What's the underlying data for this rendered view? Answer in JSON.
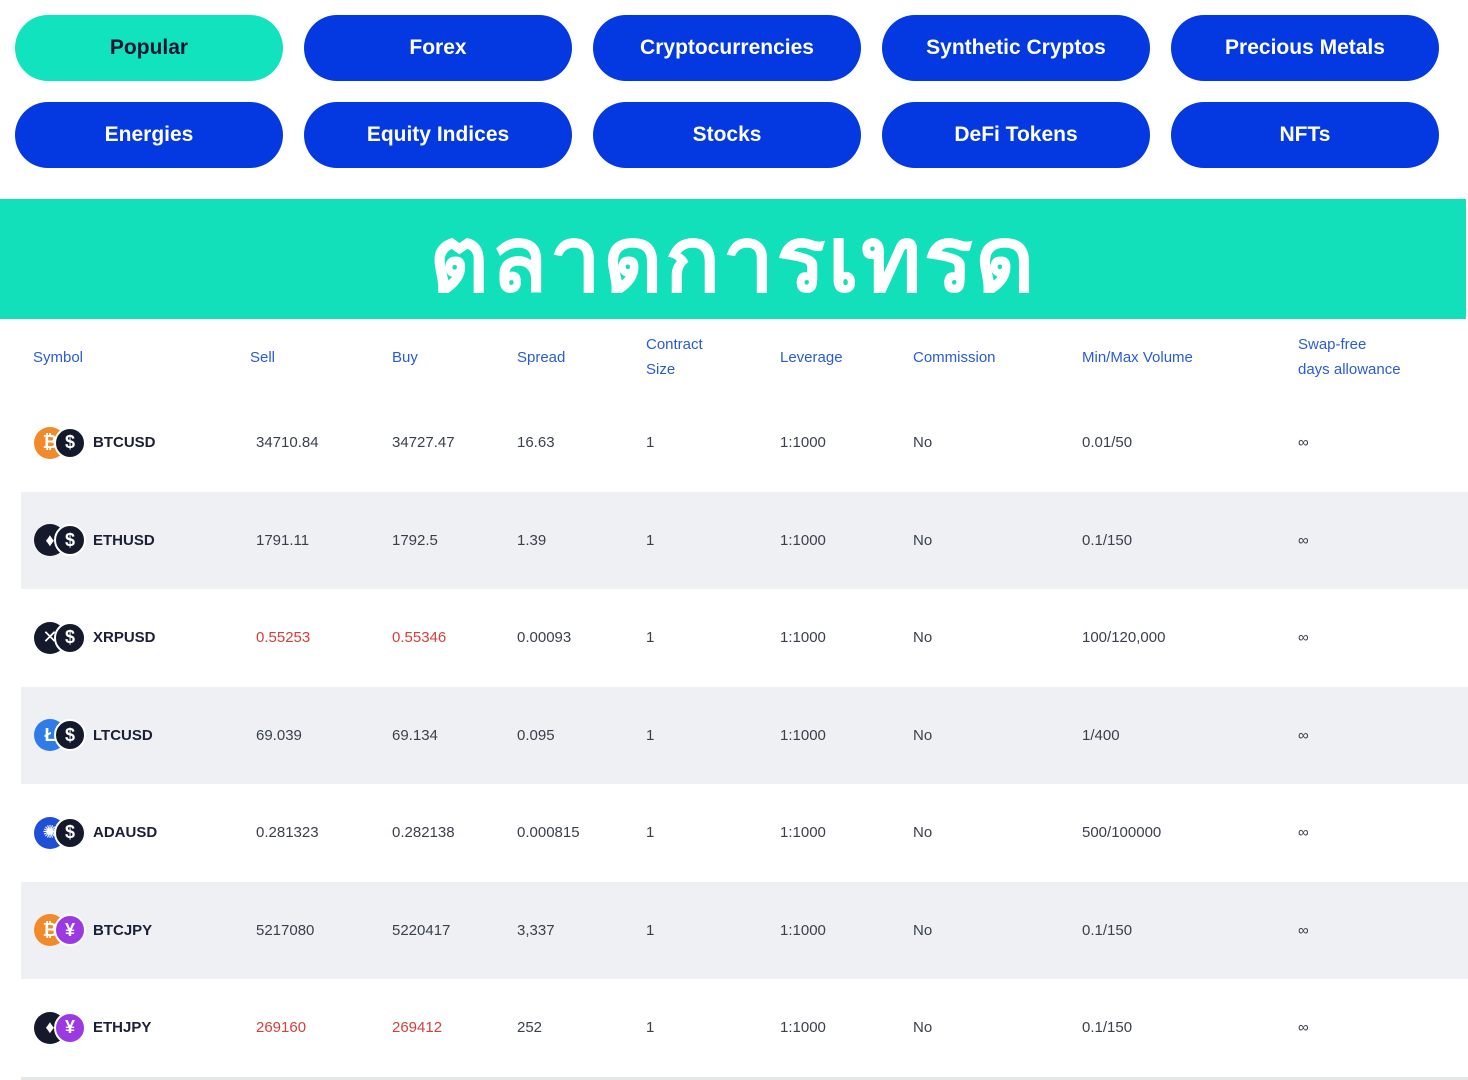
{
  "tabs": [
    {
      "label": "Popular",
      "active": true
    },
    {
      "label": "Forex"
    },
    {
      "label": "Cryptocurrencies"
    },
    {
      "label": "Synthetic Cryptos"
    },
    {
      "label": "Precious Metals"
    },
    {
      "label": "Energies"
    },
    {
      "label": "Equity Indices"
    },
    {
      "label": "Stocks"
    },
    {
      "label": "DeFi Tokens"
    },
    {
      "label": "NFTs"
    }
  ],
  "banner": {
    "text": "ตลาดการเทรด"
  },
  "table": {
    "headers": {
      "symbol": "Symbol",
      "sell": "Sell",
      "buy": "Buy",
      "spread": "Spread",
      "contract_size_1": "Contract",
      "contract_size_2": "Size",
      "leverage": "Leverage",
      "commission": "Commission",
      "volume": "Min/Max Volume",
      "swap_1": "Swap-free",
      "swap_2": "days allowance"
    },
    "rows": [
      {
        "symbol": "BTCUSD",
        "base_icon": "bitcoin-icon",
        "quote_icon": "dollar-icon",
        "sell": "34710.84",
        "buy": "34727.47",
        "spread": "16.63",
        "contract": "1",
        "leverage": "1:1000",
        "commission": "No",
        "volume": "0.01/50",
        "swap": "∞"
      },
      {
        "symbol": "ETHUSD",
        "base_icon": "ethereum-icon",
        "quote_icon": "dollar-icon",
        "sell": "1791.11",
        "buy": "1792.5",
        "spread": "1.39",
        "contract": "1",
        "leverage": "1:1000",
        "commission": "No",
        "volume": "0.1/150",
        "swap": "∞"
      },
      {
        "symbol": "XRPUSD",
        "base_icon": "xrp-icon",
        "quote_icon": "dollar-icon",
        "sell": "0.55253",
        "buy": "0.55346",
        "spread": "0.00093",
        "contract": "1",
        "leverage": "1:1000",
        "commission": "No",
        "volume": "100/120,000",
        "swap": "∞"
      },
      {
        "symbol": "LTCUSD",
        "base_icon": "litecoin-icon",
        "quote_icon": "dollar-icon",
        "sell": "69.039",
        "buy": "69.134",
        "spread": "0.095",
        "contract": "1",
        "leverage": "1:1000",
        "commission": "No",
        "volume": "1/400",
        "swap": "∞"
      },
      {
        "symbol": "ADAUSD",
        "base_icon": "cardano-icon",
        "quote_icon": "dollar-icon",
        "sell": "0.281323",
        "buy": "0.282138",
        "spread": "0.000815",
        "contract": "1",
        "leverage": "1:1000",
        "commission": "No",
        "volume": "500/100000",
        "swap": "∞"
      },
      {
        "symbol": "BTCJPY",
        "base_icon": "bitcoin-icon",
        "quote_icon": "yen-icon",
        "sell": "5217080",
        "buy": "5220417",
        "spread": "3,337",
        "contract": "1",
        "leverage": "1:1000",
        "commission": "No",
        "volume": "0.1/150",
        "swap": "∞"
      },
      {
        "symbol": "ETHJPY",
        "base_icon": "ethereum-icon",
        "quote_icon": "yen-icon",
        "sell": "269160",
        "buy": "269412",
        "spread": "252",
        "contract": "1",
        "leverage": "1:1000",
        "commission": "No",
        "volume": "0.1/150",
        "swap": "∞"
      }
    ]
  },
  "colors": {
    "tab_blue": "#0438e0",
    "accent_teal": "#12e3bf",
    "header_blue": "#2a5bd7",
    "price_down_red": "#d0403c",
    "row_alt_bg": "#eef0f3"
  }
}
